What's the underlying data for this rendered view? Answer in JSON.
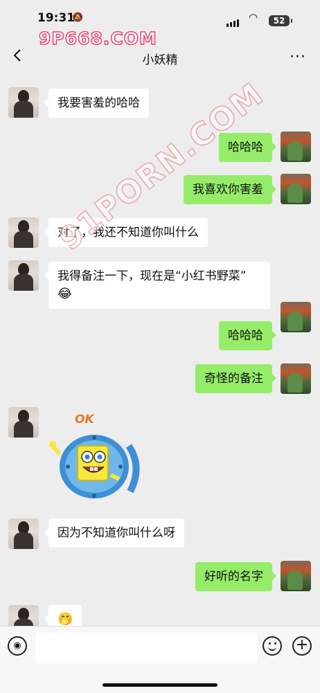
{
  "status": {
    "time": "19:31",
    "battery": "52",
    "watermark_top": "9P668.COM"
  },
  "nav": {
    "title": "小妖精",
    "more_icon": "more-icon",
    "back_icon": "chevron-left-icon"
  },
  "watermark_diagonal": "91PORN.COM",
  "messages": [
    {
      "side": "left",
      "text": "我要害羞的哈哈"
    },
    {
      "side": "right",
      "text": "哈哈哈"
    },
    {
      "side": "right",
      "text": "我喜欢你害羞"
    },
    {
      "side": "left",
      "text": "对了，我还不知道你叫什么"
    },
    {
      "side": "left",
      "text": "我得备注一下，现在是“小红书野菜”",
      "emoji": "😂"
    },
    {
      "side": "right",
      "text": "哈哈哈"
    },
    {
      "side": "right",
      "text": "奇怪的备注"
    },
    {
      "side": "left",
      "sticker": "spongebob-ok-sticker",
      "sticker_text": "OK"
    },
    {
      "side": "left",
      "text": "因为不知道你叫什么呀"
    },
    {
      "side": "right",
      "text": "好听的名字"
    },
    {
      "side": "left",
      "emoji": "🤭"
    }
  ],
  "input": {
    "voice_icon": "voice-icon",
    "emoji_icon": "emoji-icon",
    "plus_icon": "plus-icon",
    "placeholder": ""
  }
}
